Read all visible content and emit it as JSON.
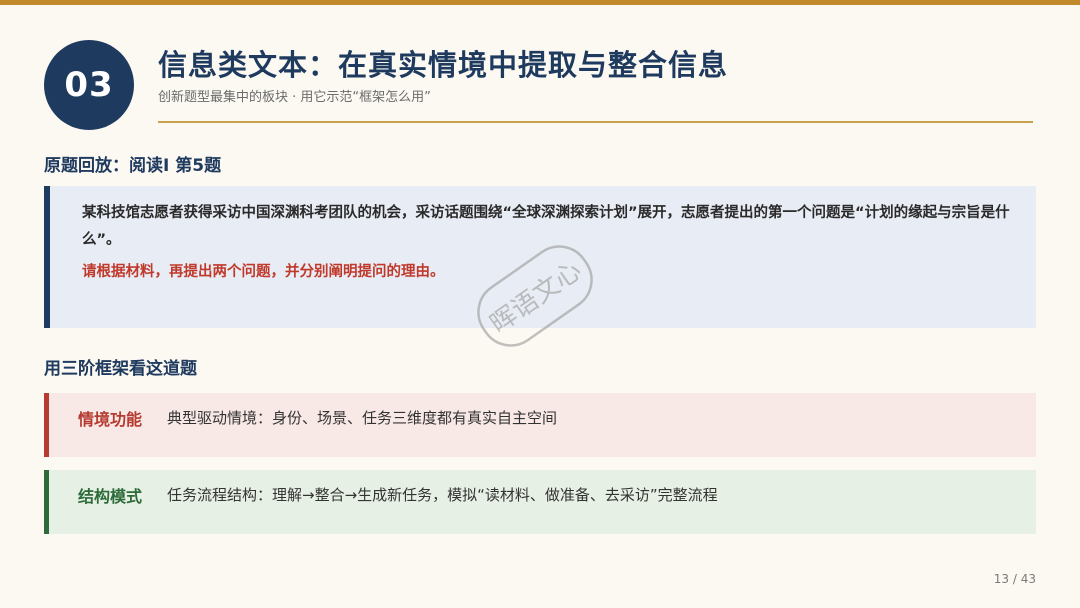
{
  "slide": {
    "badge": "03",
    "title": "信息类文本：在真实情境中提取与整合信息",
    "subtitle": "创新题型最集中的板块 · 用它示范“框架怎么用”",
    "colors": {
      "navy": "#1f3a5f",
      "gold": "#c0892a",
      "red": "#b53a30",
      "green": "#2e6b3a"
    }
  },
  "original": {
    "heading": "原题回放：阅读Ⅰ 第5题",
    "question": "某科技馆志愿者获得采访中国深渊科考团队的机会，采访话题围绕“全球深渊探索计划”展开，志愿者提出的第一个问题是“计划的缘起与宗旨是什么”。",
    "prompt": "请根据材料，再提出两个问题，并分别阐明提问的理由。"
  },
  "framework": {
    "heading": "用三阶框架看这道题",
    "cards": [
      {
        "label": "情境功能",
        "desc": "典型驱动情境：身份、场景、任务三维度都有真实自主空间"
      },
      {
        "label": "结构模式",
        "desc": "任务流程结构：理解→整合→生成新任务，模拟“读材料、做准备、去采访”完整流程"
      }
    ]
  },
  "watermark": {
    "text": "晖语文心"
  },
  "footer": {
    "page": "13 / 43"
  }
}
